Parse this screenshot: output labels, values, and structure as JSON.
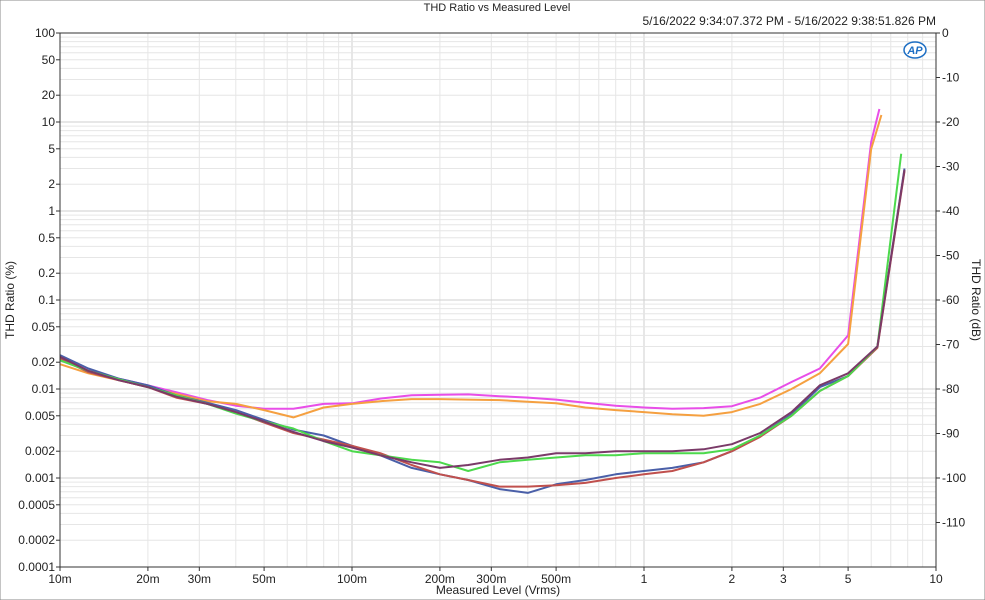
{
  "chart_data": {
    "type": "line",
    "title": "THD Ratio vs Measured Level",
    "subtitle": "5/16/2022 9:34:07.372 PM - 5/16/2022 9:38:51.826 PM",
    "xlabel": "Measured Level (Vrms)",
    "ylabel": "THD Ratio (%)",
    "y2label": "THD Ratio (dB)",
    "xscale": "log",
    "yscale": "log",
    "xlim": [
      0.01,
      10
    ],
    "ylim": [
      0.0001,
      100
    ],
    "y2lim": [
      -120,
      0
    ],
    "grid": true,
    "logo_text": "AP",
    "x_ticks": [
      {
        "v": 0.01,
        "label": "10m"
      },
      {
        "v": 0.02,
        "label": "20m"
      },
      {
        "v": 0.03,
        "label": "30m"
      },
      {
        "v": 0.05,
        "label": "50m"
      },
      {
        "v": 0.1,
        "label": "100m"
      },
      {
        "v": 0.2,
        "label": "200m"
      },
      {
        "v": 0.3,
        "label": "300m"
      },
      {
        "v": 0.5,
        "label": "500m"
      },
      {
        "v": 1,
        "label": "1"
      },
      {
        "v": 2,
        "label": "2"
      },
      {
        "v": 3,
        "label": "3"
      },
      {
        "v": 5,
        "label": "5"
      },
      {
        "v": 10,
        "label": "10"
      }
    ],
    "y_ticks": [
      {
        "v": 100,
        "label": "100"
      },
      {
        "v": 50,
        "label": "50"
      },
      {
        "v": 20,
        "label": "20"
      },
      {
        "v": 10,
        "label": "10"
      },
      {
        "v": 5,
        "label": "5"
      },
      {
        "v": 2,
        "label": "2"
      },
      {
        "v": 1,
        "label": "1"
      },
      {
        "v": 0.5,
        "label": "0.5"
      },
      {
        "v": 0.2,
        "label": "0.2"
      },
      {
        "v": 0.1,
        "label": "0.1"
      },
      {
        "v": 0.05,
        "label": "0.05"
      },
      {
        "v": 0.02,
        "label": "0.02"
      },
      {
        "v": 0.01,
        "label": "0.01"
      },
      {
        "v": 0.005,
        "label": "0.005"
      },
      {
        "v": 0.002,
        "label": "0.002"
      },
      {
        "v": 0.001,
        "label": "0.001"
      },
      {
        "v": 0.0005,
        "label": "0.0005"
      },
      {
        "v": 0.0002,
        "label": "0.0002"
      },
      {
        "v": 0.0001,
        "label": "0.0001"
      }
    ],
    "y2_ticks": [
      {
        "v": 0,
        "label": "0"
      },
      {
        "v": -10,
        "label": "-10"
      },
      {
        "v": -20,
        "label": "-20"
      },
      {
        "v": -30,
        "label": "-30"
      },
      {
        "v": -40,
        "label": "-40"
      },
      {
        "v": -50,
        "label": "-50"
      },
      {
        "v": -60,
        "label": "-60"
      },
      {
        "v": -70,
        "label": "-70"
      },
      {
        "v": -80,
        "label": "-80"
      },
      {
        "v": -90,
        "label": "-90"
      },
      {
        "v": -100,
        "label": "-100"
      },
      {
        "v": -110,
        "label": "-110"
      }
    ],
    "series": [
      {
        "color": "#e84ee8",
        "x": [
          0.01,
          0.0125,
          0.016,
          0.02,
          0.025,
          0.032,
          0.04,
          0.05,
          0.063,
          0.08,
          0.1,
          0.125,
          0.16,
          0.2,
          0.25,
          0.32,
          0.4,
          0.5,
          0.63,
          0.8,
          1.0,
          1.25,
          1.6,
          2.0,
          2.5,
          3.2,
          4.0,
          5.0,
          6.0,
          6.4
        ],
        "y": [
          0.021,
          0.016,
          0.013,
          0.011,
          0.0092,
          0.0075,
          0.0065,
          0.006,
          0.006,
          0.0068,
          0.0069,
          0.0078,
          0.0085,
          0.0086,
          0.0087,
          0.0083,
          0.008,
          0.0076,
          0.007,
          0.0065,
          0.0062,
          0.006,
          0.0061,
          0.0064,
          0.008,
          0.012,
          0.017,
          0.04,
          6.0,
          14.0
        ]
      },
      {
        "color": "#f5a040",
        "x": [
          0.01,
          0.0125,
          0.016,
          0.02,
          0.025,
          0.032,
          0.04,
          0.05,
          0.063,
          0.08,
          0.1,
          0.125,
          0.16,
          0.2,
          0.25,
          0.32,
          0.4,
          0.5,
          0.63,
          0.8,
          1.0,
          1.25,
          1.6,
          2.0,
          2.5,
          3.2,
          4.0,
          5.0,
          6.0,
          6.5
        ],
        "y": [
          0.019,
          0.015,
          0.0125,
          0.0105,
          0.0088,
          0.0073,
          0.0068,
          0.0058,
          0.0048,
          0.0062,
          0.0068,
          0.0073,
          0.0077,
          0.0077,
          0.0076,
          0.0075,
          0.0072,
          0.0069,
          0.0062,
          0.0058,
          0.0055,
          0.0052,
          0.005,
          0.0055,
          0.0068,
          0.01,
          0.015,
          0.032,
          5.0,
          12.0
        ]
      },
      {
        "color": "#4a5fa8",
        "x": [
          0.01,
          0.0125,
          0.016,
          0.02,
          0.025,
          0.032,
          0.04,
          0.05,
          0.063,
          0.08,
          0.1,
          0.125,
          0.16,
          0.2,
          0.25,
          0.32,
          0.4,
          0.5,
          0.63,
          0.8,
          1.0,
          1.25,
          1.6,
          2.0,
          2.5,
          3.2,
          4.0,
          5.0,
          6.3,
          7.8
        ],
        "y": [
          0.024,
          0.017,
          0.013,
          0.011,
          0.0085,
          0.007,
          0.0058,
          0.0045,
          0.0035,
          0.003,
          0.0023,
          0.0018,
          0.0013,
          0.0011,
          0.00095,
          0.00075,
          0.00068,
          0.00085,
          0.00095,
          0.0011,
          0.0012,
          0.0013,
          0.0015,
          0.002,
          0.003,
          0.0052,
          0.0105,
          0.014,
          0.03,
          3.0
        ]
      },
      {
        "color": "#c0504d",
        "x": [
          0.01,
          0.0125,
          0.016,
          0.02,
          0.025,
          0.032,
          0.04,
          0.05,
          0.063,
          0.08,
          0.1,
          0.125,
          0.16,
          0.2,
          0.25,
          0.32,
          0.4,
          0.5,
          0.63,
          0.8,
          1.0,
          1.25,
          1.6,
          2.0,
          2.5,
          3.2,
          4.0,
          5.0,
          6.3,
          7.8
        ],
        "y": [
          0.022,
          0.0155,
          0.0125,
          0.0105,
          0.008,
          0.0068,
          0.0055,
          0.0042,
          0.0032,
          0.0027,
          0.0023,
          0.0019,
          0.0014,
          0.0011,
          0.00095,
          0.0008,
          0.0008,
          0.00083,
          0.00088,
          0.001,
          0.0011,
          0.0012,
          0.0015,
          0.002,
          0.0029,
          0.005,
          0.0095,
          0.014,
          0.029,
          2.8
        ]
      },
      {
        "color": "#4cd94c",
        "x": [
          0.01,
          0.0125,
          0.016,
          0.02,
          0.025,
          0.032,
          0.04,
          0.05,
          0.063,
          0.08,
          0.1,
          0.125,
          0.16,
          0.2,
          0.25,
          0.32,
          0.4,
          0.5,
          0.63,
          0.8,
          1.0,
          1.25,
          1.6,
          2.0,
          2.5,
          3.2,
          4.0,
          5.0,
          6.3,
          7.6
        ],
        "y": [
          0.021,
          0.016,
          0.0128,
          0.0105,
          0.0085,
          0.0068,
          0.0053,
          0.0043,
          0.0036,
          0.0026,
          0.002,
          0.0018,
          0.0016,
          0.0015,
          0.0012,
          0.0015,
          0.0016,
          0.0017,
          0.0018,
          0.0018,
          0.0019,
          0.0019,
          0.0019,
          0.0021,
          0.003,
          0.005,
          0.0095,
          0.014,
          0.03,
          4.4
        ]
      },
      {
        "color": "#7a3a68",
        "x": [
          0.01,
          0.0125,
          0.016,
          0.02,
          0.025,
          0.032,
          0.04,
          0.05,
          0.063,
          0.08,
          0.1,
          0.125,
          0.16,
          0.2,
          0.25,
          0.32,
          0.4,
          0.5,
          0.63,
          0.8,
          1.0,
          1.25,
          1.6,
          2.0,
          2.5,
          3.2,
          4.0,
          5.0,
          6.3,
          7.8
        ],
        "y": [
          0.023,
          0.016,
          0.0125,
          0.0105,
          0.0082,
          0.0068,
          0.0055,
          0.0043,
          0.0033,
          0.0026,
          0.0022,
          0.0018,
          0.0015,
          0.0013,
          0.0014,
          0.0016,
          0.0017,
          0.0019,
          0.0019,
          0.002,
          0.002,
          0.002,
          0.0021,
          0.0024,
          0.0032,
          0.0055,
          0.011,
          0.015,
          0.03,
          2.9
        ]
      }
    ]
  }
}
